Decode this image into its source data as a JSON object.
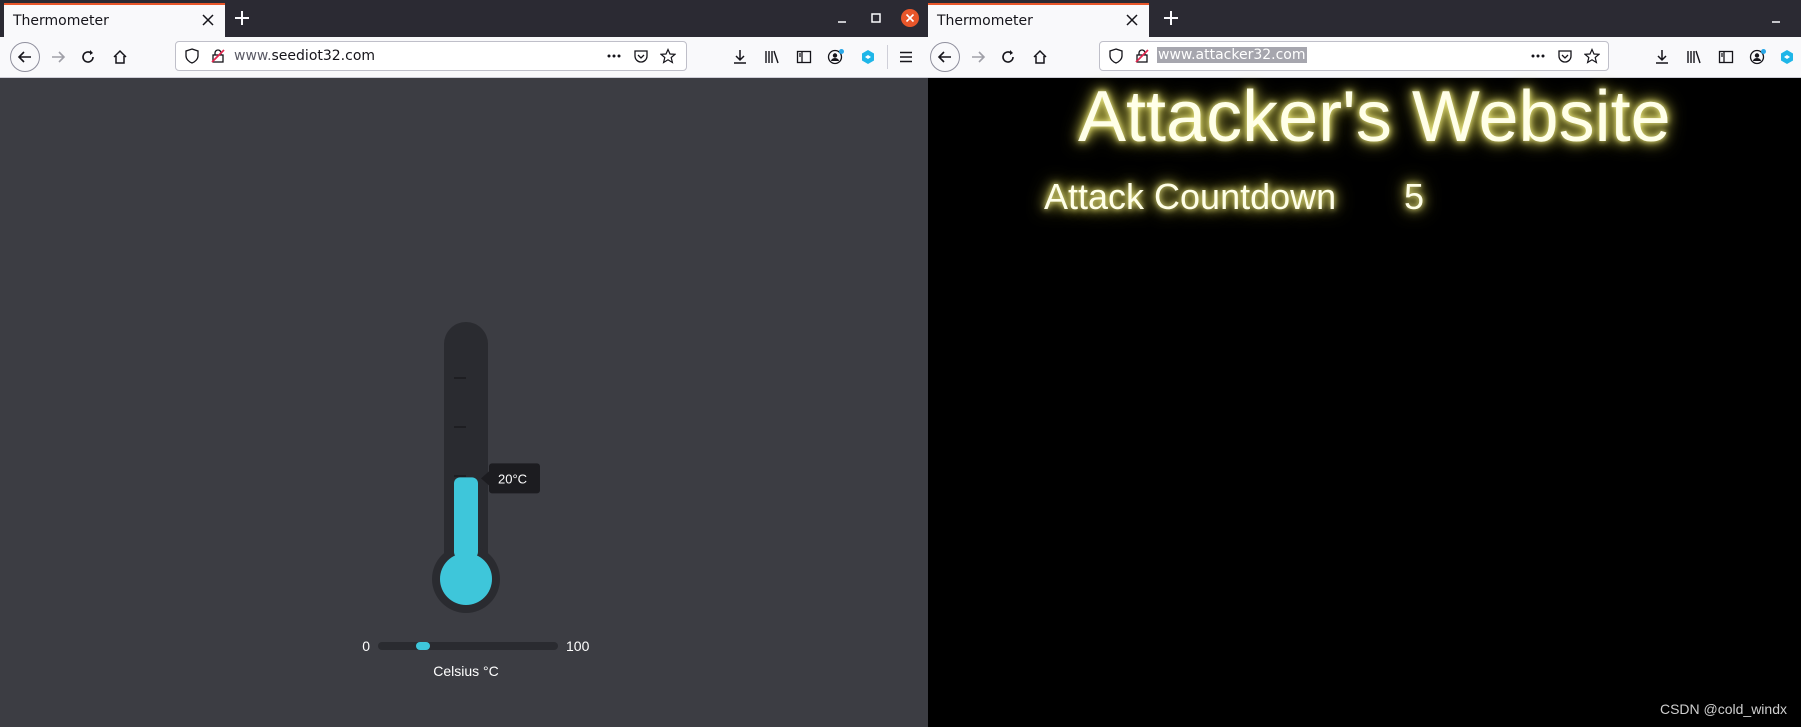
{
  "left": {
    "tab_title": "Thermometer",
    "url_prefix": "www.",
    "url_domain": "seediot32.com",
    "thermometer": {
      "temp_label": "20°C",
      "value": 20,
      "min": 0,
      "max": 100,
      "min_label": "0",
      "max_label": "100",
      "unit_label": "Celsius °C"
    }
  },
  "right": {
    "tab_title": "Thermometer",
    "url": "www.attacker32.com",
    "heading": "Attacker's Website",
    "countdown_label": "Attack Countdown",
    "countdown_value": "5"
  },
  "watermark": "CSDN @cold_windx",
  "colors": {
    "accent": "#e8562a",
    "gauge_fill": "#3ec6da",
    "gauge_body": "#2a2b30",
    "page_bg": "#3c3d43",
    "glow": "#f4f08a"
  }
}
